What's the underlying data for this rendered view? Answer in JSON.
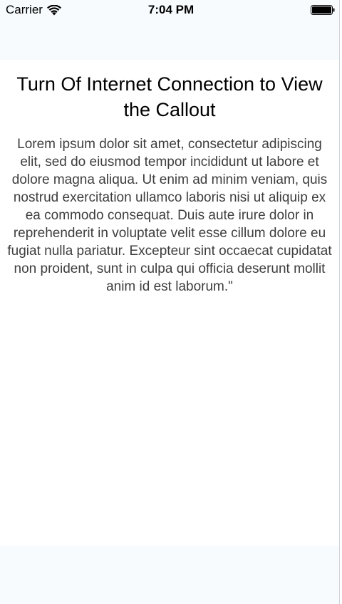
{
  "status_bar": {
    "carrier": "Carrier",
    "time": "7:04 PM",
    "wifi_icon": "wifi-icon",
    "battery_icon": "battery-icon"
  },
  "content": {
    "title": "Turn Of Internet Connection to View the Callout",
    "body": "Lorem ipsum dolor sit amet, consectetur adipiscing elit, sed do eiusmod tempor incididunt ut labore et dolore magna aliqua. Ut enim ad minim veniam, quis nostrud exercitation ullamco laboris nisi ut aliquip ex ea commodo consequat. Duis aute irure dolor in reprehenderit in voluptate velit esse cillum dolore eu fugiat nulla pariatur. Excepteur sint occaecat cupidatat non proident, sunt in culpa qui officia deserunt mollit anim id est laborum.\""
  },
  "colors": {
    "background": "#f7fbfe",
    "content_background": "#ffffff",
    "title_text": "#000000",
    "body_text": "#3d3d3d"
  }
}
